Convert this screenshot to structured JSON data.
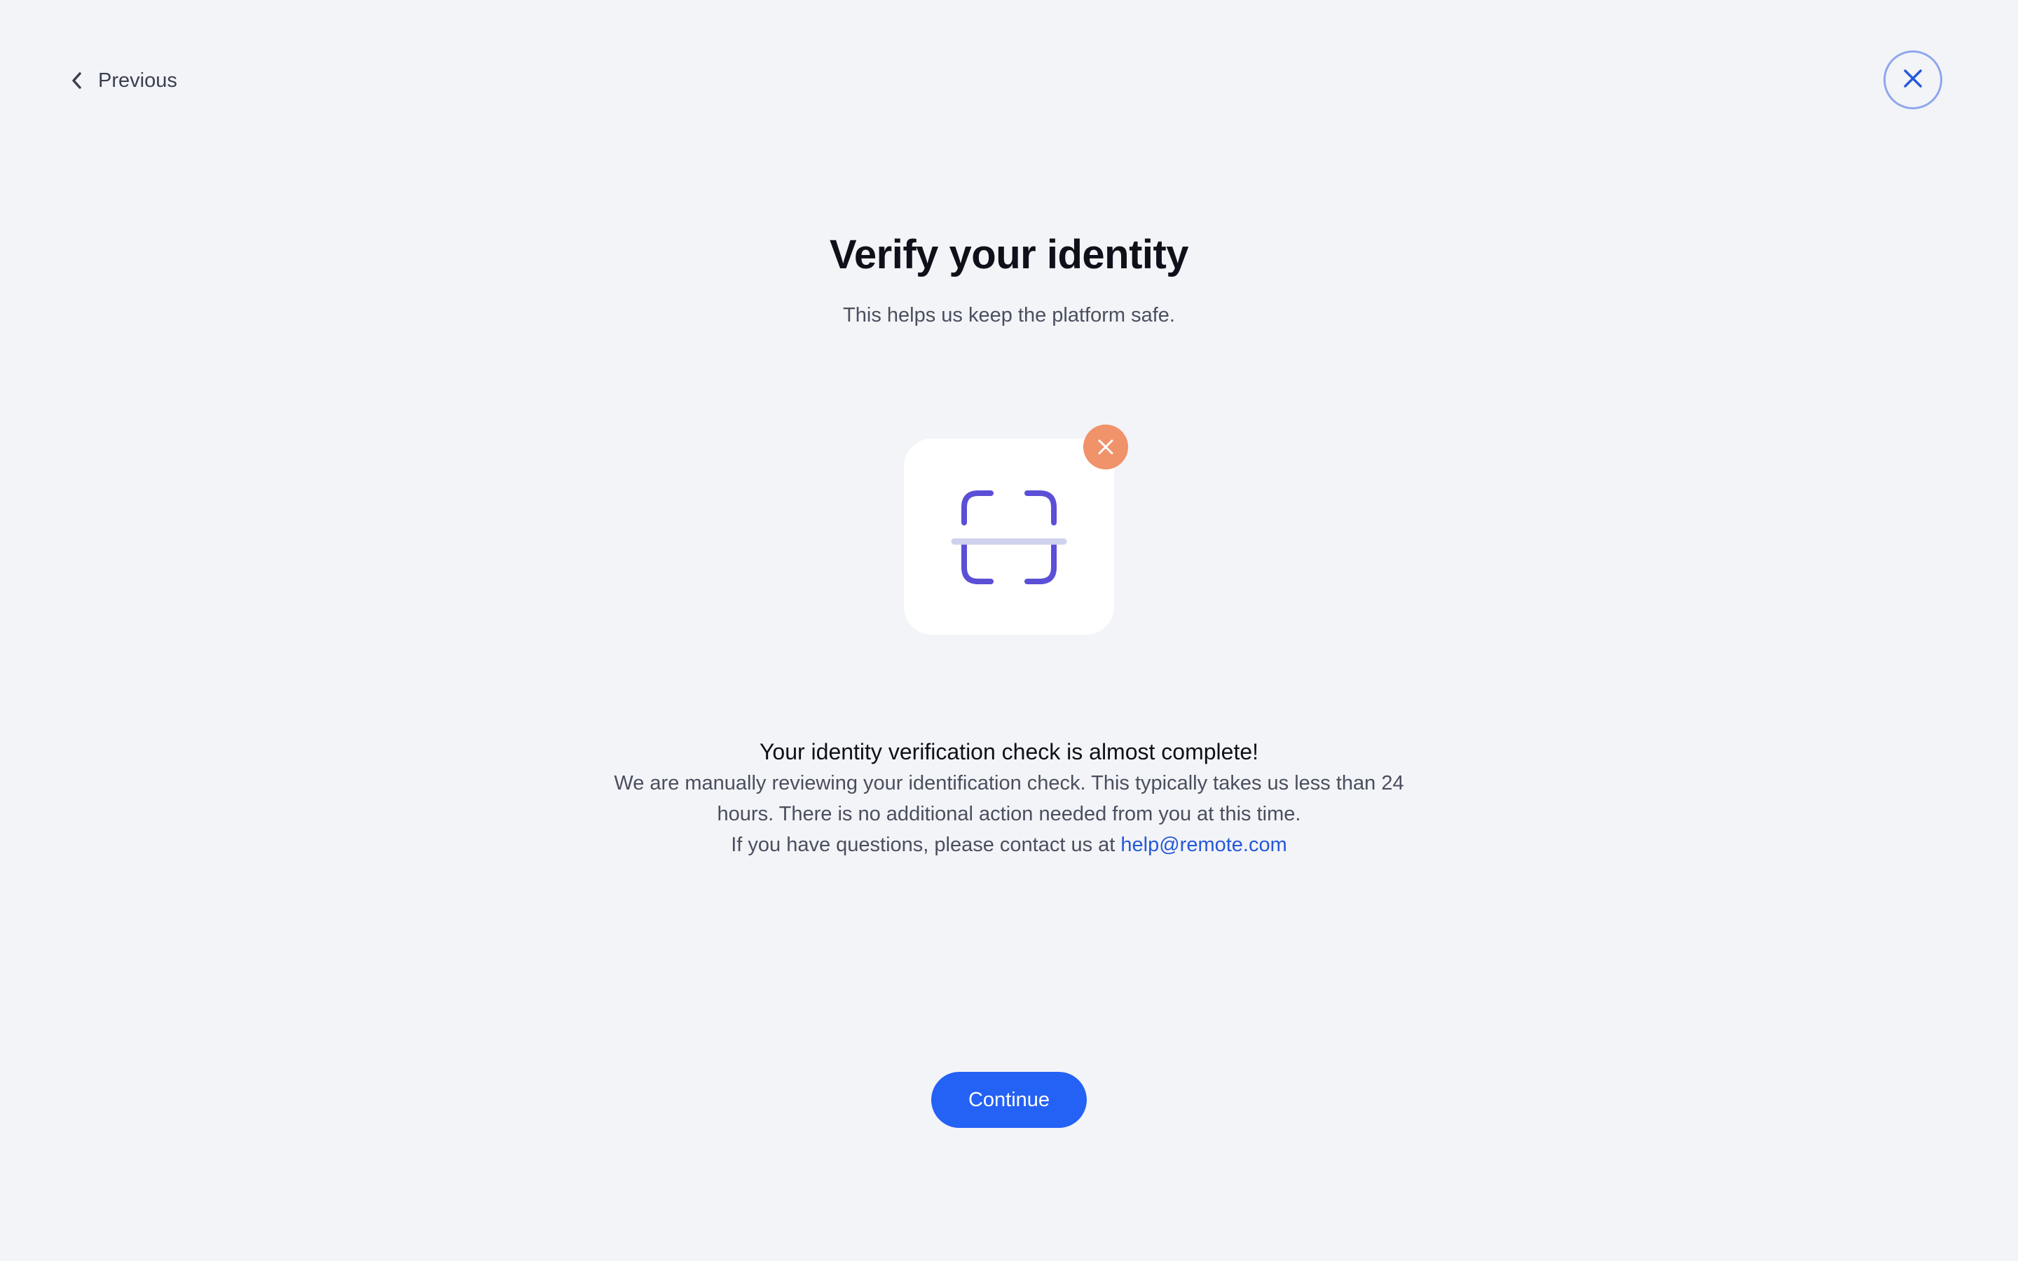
{
  "nav": {
    "previous_label": "Previous"
  },
  "header": {
    "title": "Verify your identity",
    "subtitle": "This helps us keep the platform safe."
  },
  "status": {
    "title": "Your identity verification check is almost complete!",
    "body_text": "We are manually reviewing your identification check. This typically takes us less than 24 hours. There is no additional action needed from you at this time.",
    "contact_prefix": "If you have questions, please contact us at",
    "contact_email": "help@remote.com"
  },
  "actions": {
    "continue_label": "Continue"
  },
  "icons": {
    "back": "chevron-left-icon",
    "close": "close-icon",
    "scan": "face-scan-icon",
    "error": "x-badge-icon"
  },
  "colors": {
    "background": "#f3f4f8",
    "primary": "#2461f5",
    "link": "#2559d9",
    "scan_frame": "#5b4fd6",
    "scan_line": "#cfd2ee",
    "error_badge": "#f0926a",
    "close_ring": "#8ea7ee"
  }
}
